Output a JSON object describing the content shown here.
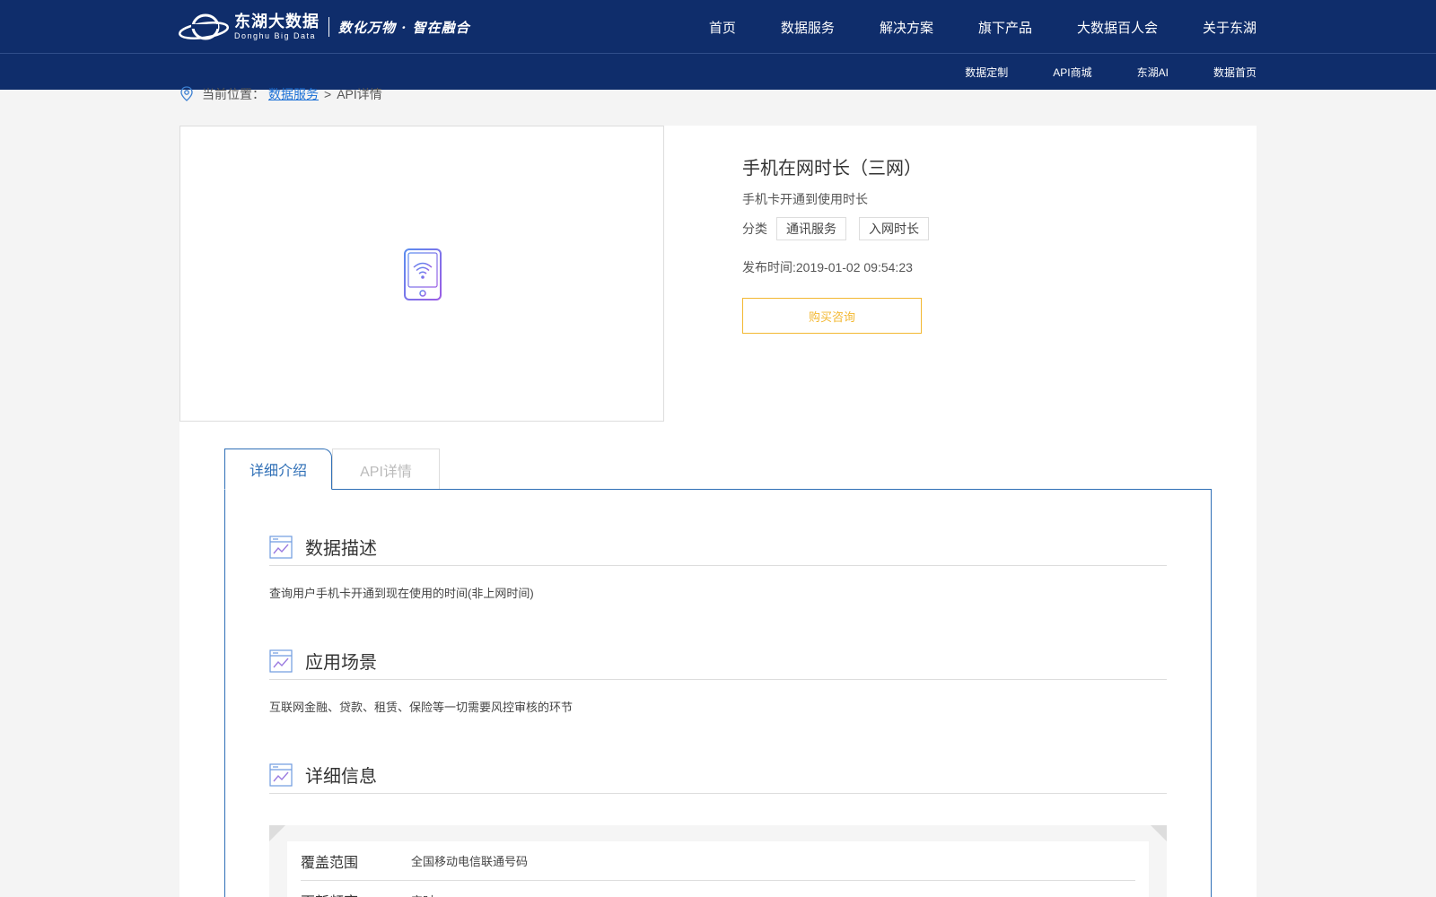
{
  "header": {
    "logo_cn": "东湖大数据",
    "logo_en": "Donghu Big Data",
    "slogan": "数化万物 · 智在融合",
    "nav": [
      "首页",
      "数据服务",
      "解决方案",
      "旗下产品",
      "大数据百人会",
      "关于东湖"
    ],
    "subnav": [
      "数据定制",
      "API商城",
      "东湖AI",
      "数据首页"
    ]
  },
  "breadcrumb": {
    "prefix": "当前位置：",
    "link": "数据服务",
    "sep": ">",
    "current": "API详情"
  },
  "product": {
    "icon": "phone-wifi-icon",
    "title": "手机在网时长（三网）",
    "subtitle": "手机卡开通到使用时长",
    "category_label": "分类",
    "tags": [
      "通讯服务",
      "入网时长"
    ],
    "publish_time": "发布时间:2019-01-02 09:54:23",
    "buy_label": "购买咨询"
  },
  "tabs": [
    "详细介绍",
    "API详情"
  ],
  "sections": {
    "desc": {
      "title": "数据描述",
      "text": "查询用户手机卡开通到现在使用的时间(非上网时间)"
    },
    "scene": {
      "title": "应用场景",
      "text": "互联网金融、贷款、租赁、保险等一切需要风控审核的环节"
    },
    "info": {
      "title": "详细信息"
    }
  },
  "info_rows": [
    {
      "key": "覆盖范围",
      "value": "全国移动电信联通号码"
    },
    {
      "key": "更新频率",
      "value": "实时"
    }
  ],
  "colors": {
    "header_bg": "#0f2d6b",
    "accent_blue": "#2f6fb6",
    "link_blue": "#1a6fd6",
    "buy_orange": "#f3b832"
  }
}
